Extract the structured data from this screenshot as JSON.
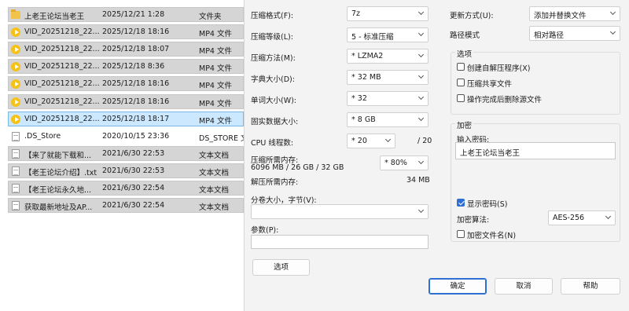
{
  "files": [
    {
      "icon": "folder-icon",
      "name": "上老王论坛当老王",
      "date": "2025/12/21 1:28",
      "type": "文件夹"
    },
    {
      "icon": "video-file-icon",
      "name": "VID_20251218_22...",
      "date": "2025/12/18 18:16",
      "type": "MP4 文件"
    },
    {
      "icon": "video-file-icon",
      "name": "VID_20251218_22...",
      "date": "2025/12/18 18:07",
      "type": "MP4 文件"
    },
    {
      "icon": "video-file-icon",
      "name": "VID_20251218_22...",
      "date": "2025/12/18 8:36",
      "type": "MP4 文件"
    },
    {
      "icon": "video-file-icon",
      "name": "VID_20251218_22...",
      "date": "2025/12/18 18:16",
      "type": "MP4 文件"
    },
    {
      "icon": "video-file-icon",
      "name": "VID_20251218_22...",
      "date": "2025/12/18 18:16",
      "type": "MP4 文件"
    },
    {
      "icon": "video-file-icon",
      "name": "VID_20251218_22...",
      "date": "2025/12/18 18:17",
      "type": "MP4 文件"
    },
    {
      "icon": "document-icon",
      "name": ".DS_Store",
      "date": "2020/10/15 23:36",
      "type": "DS_STORE 文..."
    },
    {
      "icon": "document-icon",
      "name": "【来了就能下载和...",
      "date": "2021/6/30 22:53",
      "type": "文本文档"
    },
    {
      "icon": "document-icon",
      "name": "【老王论坛介绍】.txt",
      "date": "2021/6/30 22:53",
      "type": "文本文档"
    },
    {
      "icon": "document-icon",
      "name": "【老王论坛永久地...",
      "date": "2021/6/30 22:54",
      "type": "文本文档"
    },
    {
      "icon": "document-icon",
      "name": "获取最新地址及AP...",
      "date": "2021/6/30 22:54",
      "type": "文本文档"
    }
  ],
  "dialog": {
    "format_label": "压缩格式(F):",
    "format_value": "7z",
    "level_label": "压缩等级(L):",
    "level_value": "5 - 标准压缩",
    "method_label": "压缩方法(M):",
    "method_value": "* LZMA2",
    "dict_label": "字典大小(D):",
    "dict_value": "* 32 MB",
    "word_label": "单词大小(W):",
    "word_value": "* 32",
    "solid_label": "固实数据大小:",
    "solid_value": "* 8 GB",
    "threads_label": "CPU 线程数:",
    "threads_value": "* 20",
    "threads_total": "/ 20",
    "mem_comp_label": "压缩所需内存:",
    "mem_comp_value": "6096 MB / 26 GB / 32 GB",
    "mem_percent": "* 80%",
    "mem_decomp_label": "解压所需内存:",
    "mem_decomp_value": "34 MB",
    "split_label": "分卷大小，字节(V):",
    "split_value": "",
    "params_label": "参数(P):",
    "params_value": "",
    "options_button": "选项",
    "update_label": "更新方式(U):",
    "update_value": "添加并替换文件",
    "path_label": "路径模式",
    "path_value": "相对路径",
    "options_group_title": "选项",
    "opt_sfx": "创建自解压程序(X)",
    "opt_shared": "压缩共享文件",
    "opt_delete": "操作完成后删除源文件",
    "encrypt_group_title": "加密",
    "password_label": "输入密码:",
    "password_value": "上老王论坛当老王",
    "show_password": "显示密码(S)",
    "encrypt_method_label": "加密算法:",
    "encrypt_method_value": "AES-256",
    "encrypt_names": "加密文件名(N)",
    "ok": "确定",
    "cancel": "取消",
    "help": "帮助"
  }
}
